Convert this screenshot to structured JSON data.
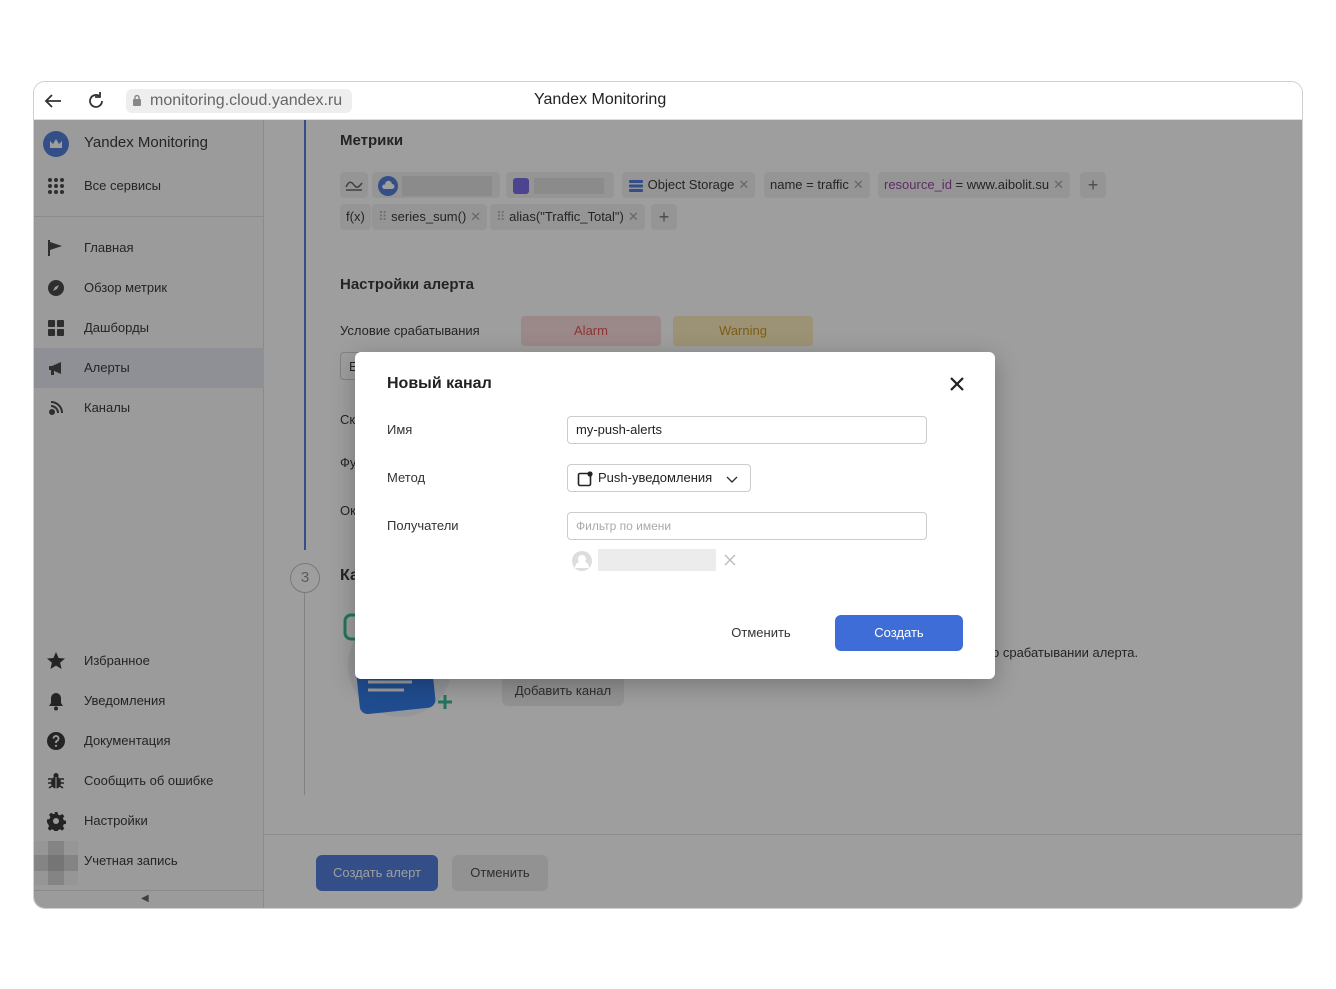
{
  "browser": {
    "url": "monitoring.cloud.yandex.ru",
    "title": "Yandex Monitoring"
  },
  "sidebar": {
    "brand": "Yandex Monitoring",
    "all_services": "Все сервисы",
    "items": [
      {
        "label": "Главная",
        "icon": "flag-icon"
      },
      {
        "label": "Обзор метрик",
        "icon": "compass-icon"
      },
      {
        "label": "Дашборды",
        "icon": "dashboard-icon"
      },
      {
        "label": "Алерты",
        "icon": "megaphone-icon",
        "active": true
      },
      {
        "label": "Каналы",
        "icon": "signal-icon"
      }
    ],
    "bottom_items": [
      {
        "label": "Избранное",
        "icon": "star-icon"
      },
      {
        "label": "Уведомления",
        "icon": "bell-icon"
      },
      {
        "label": "Документация",
        "icon": "help-icon"
      },
      {
        "label": "Сообщить об ошибке",
        "icon": "bug-icon"
      },
      {
        "label": "Настройки",
        "icon": "gear-icon"
      },
      {
        "label": "Учетная запись",
        "icon": "avatar"
      }
    ]
  },
  "main": {
    "metrics_title": "Метрики",
    "metric_chips": {
      "service": "Object Storage",
      "name_filter": "name = traffic",
      "resource_key": "resource_id",
      "resource_value": " = www.aibolit.su"
    },
    "func_chips": {
      "fx": "f(x)",
      "func1": "series_sum()",
      "func2": "alias(\"Traffic_Total\")"
    },
    "alert_settings_title": "Настройки алерта",
    "trigger_condition_label": "Условие срабатывания",
    "alarm_label": "Alarm",
    "warning_label": "Warning",
    "partial_labels": [
      "E",
      "Ск",
      "Фу",
      "Ок"
    ],
    "step_number": "3",
    "step_title_partial": "Ка",
    "channel_hint_partial": "о срабатывании алерта.",
    "add_channel_button": "Добавить канал"
  },
  "footer": {
    "create_alert": "Создать алерт",
    "cancel": "Отменить"
  },
  "modal": {
    "title": "Новый канал",
    "name_label": "Имя",
    "name_value": "my-push-alerts",
    "method_label": "Метод",
    "method_value": "Push-уведомления",
    "recipients_label": "Получатели",
    "recipients_placeholder": "Фильтр по имени",
    "cancel": "Отменить",
    "create": "Создать"
  },
  "colors": {
    "accent": "#3f6dd8",
    "alarm": "#e04040",
    "warning": "#c58a00",
    "resource_key": "#8a2f9a"
  }
}
